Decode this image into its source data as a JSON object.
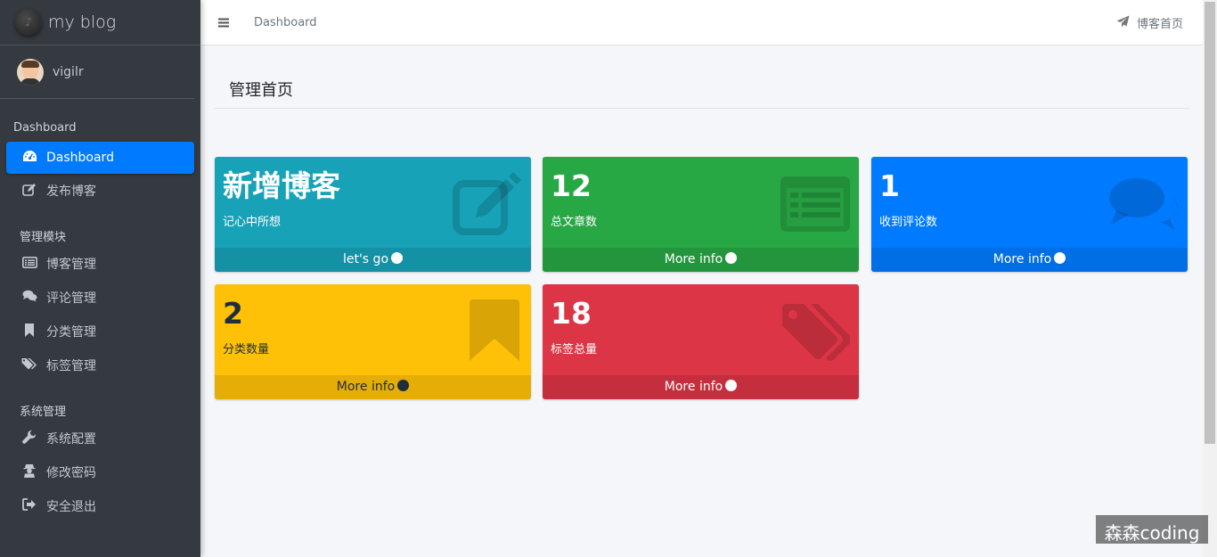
{
  "sidebar": {
    "brand": "my blog",
    "user": "vigilr",
    "header_dashboard": "Dashboard",
    "item_dashboard": "Dashboard",
    "item_publish": "发布博客",
    "header_manage": "管理模块",
    "item_blog_manage": "博客管理",
    "item_comment_manage": "评论管理",
    "item_category_manage": "分类管理",
    "item_tag_manage": "标签管理",
    "header_system": "系统管理",
    "item_system_config": "系统配置",
    "item_change_password": "修改密码",
    "item_logout": "安全退出"
  },
  "topbar": {
    "breadcrumb": "Dashboard",
    "home_link": "博客首页"
  },
  "page": {
    "title": "管理首页"
  },
  "cards": {
    "new_blog": {
      "title": "新增博客",
      "desc": "记心中所想",
      "footer": "let's go",
      "color": "#17a2b8",
      "icon": "edit-icon"
    },
    "articles": {
      "value": "12",
      "desc": "总文章数",
      "footer": "More info",
      "color": "#28a745",
      "icon": "list-alt-icon"
    },
    "comments": {
      "value": "1",
      "desc": "收到评论数",
      "footer": "More info",
      "color": "#007bff",
      "icon": "comments-icon"
    },
    "categories": {
      "value": "2",
      "desc": "分类数量",
      "footer": "More info",
      "color": "#ffc107",
      "icon": "bookmark-icon"
    },
    "tags": {
      "value": "18",
      "desc": "标签总量",
      "footer": "More info",
      "color": "#dc3545",
      "icon": "tags-icon"
    }
  },
  "watermark": "森森coding"
}
